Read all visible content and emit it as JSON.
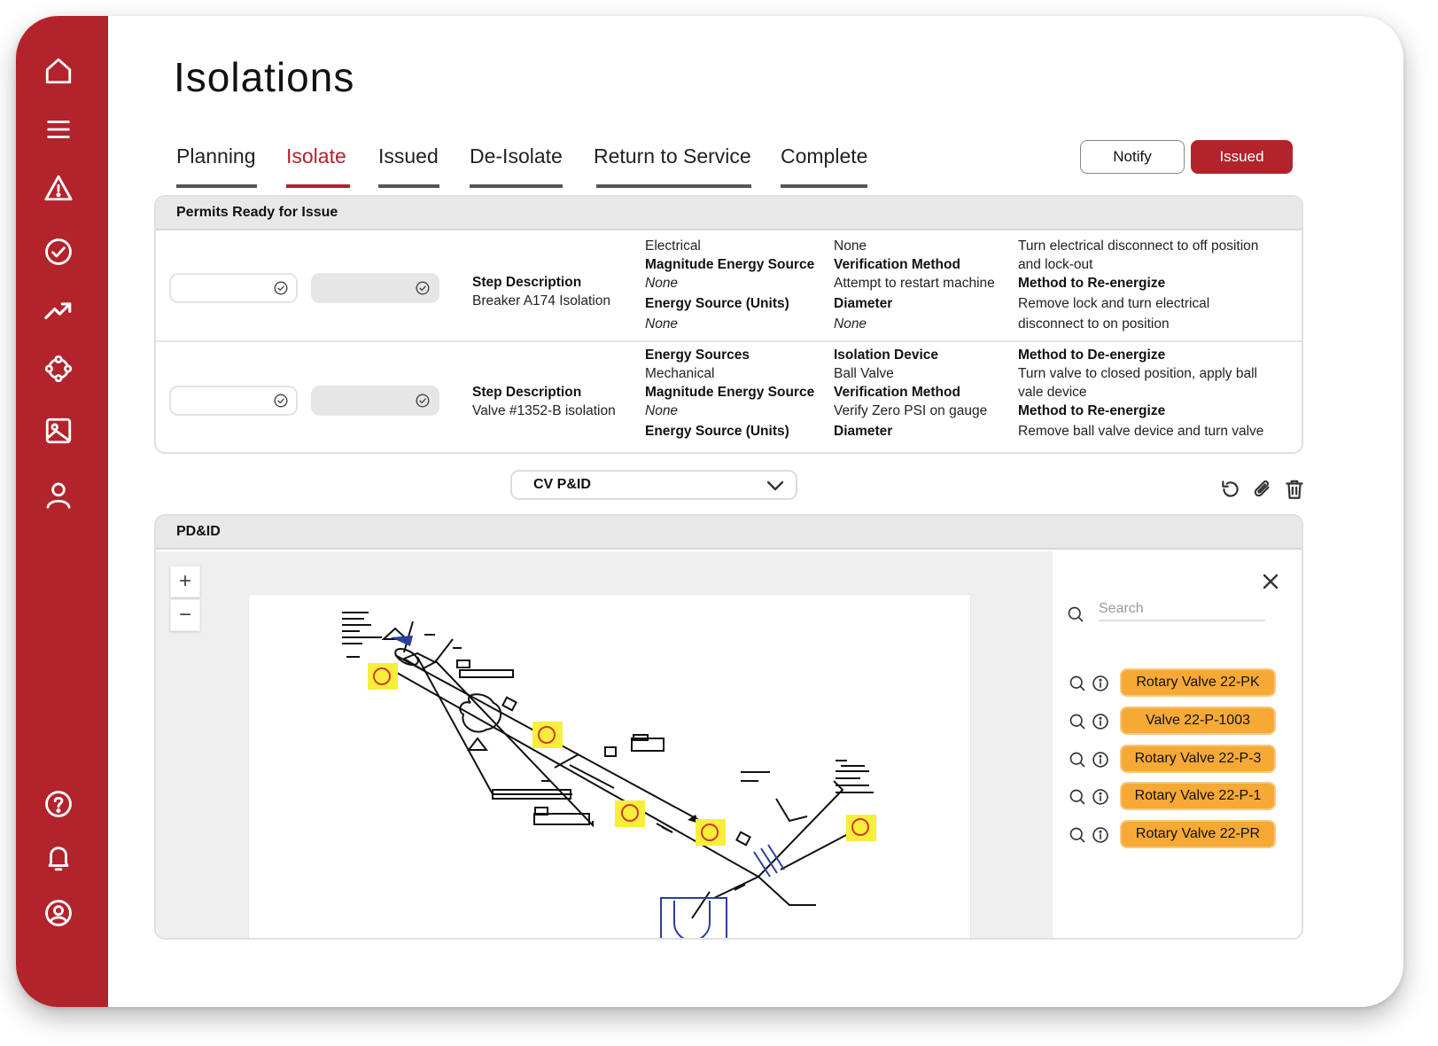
{
  "page": {
    "title": "Isolations"
  },
  "tabs": [
    {
      "label": "Planning"
    },
    {
      "label": "Isolate",
      "active": true
    },
    {
      "label": "Issued"
    },
    {
      "label": "De-Isolate"
    },
    {
      "label": "Return to Service"
    },
    {
      "label": "Complete"
    }
  ],
  "actions": {
    "notify_label": "Notify",
    "issued_label": "Issued"
  },
  "colors": {
    "brand_red": "#b3232b",
    "chip_orange": "#f6a935",
    "marker_yellow": "#f7ef3a",
    "diagram_blue": "#2b3f9c"
  },
  "sidebar": {
    "top_icons": [
      "home-icon",
      "menu-icon",
      "warning-icon",
      "check-circle-icon",
      "trending-icon",
      "network-icon",
      "image-icon",
      "user-icon"
    ],
    "bottom_icons": [
      "help-icon",
      "bell-icon",
      "account-icon"
    ]
  },
  "permits": {
    "header": "Permits Ready for Issue",
    "rows": [
      {
        "step_label": "Step Description",
        "step_value": "Breaker A174 Isolation",
        "c1": [
          "Electrical",
          "Magnitude Energy Source",
          "None",
          "Energy Source (Units)",
          "None"
        ],
        "c2": [
          "None",
          "Verification Method",
          "Attempt to restart machine",
          "Diameter",
          "None"
        ],
        "c3": [
          "Turn electrical disconnect to off position",
          "and lock-out",
          "Method to Re-energize",
          "Remove lock and turn electrical",
          "disconnect to on position"
        ]
      },
      {
        "step_label": "Step Description",
        "step_value": "Valve #1352-B isolation",
        "c1": [
          "Energy Sources",
          "Mechanical",
          "Magnitude Energy Source",
          "None",
          "Energy Source (Units)"
        ],
        "c2": [
          "Isolation Device",
          "Ball Valve",
          "Verification Method",
          "Verify Zero PSI on gauge",
          "Diameter"
        ],
        "c3": [
          "Method to De-energize",
          "Turn valve to closed position, apply ball",
          "vale device",
          "Method to Re-energize",
          "Remove ball valve device and turn valve"
        ]
      }
    ]
  },
  "diagram_select": {
    "value": "CV P&ID"
  },
  "pid": {
    "header": "PD&ID",
    "zoom_in": "+",
    "zoom_out": "−",
    "search_placeholder": "Search",
    "valves": [
      "Rotary Valve 22-PK",
      "Valve 22-P-1003",
      "Rotary Valve 22-P-3",
      "Rotary Valve 22-P-1",
      "Rotary Valve 22-PR"
    ]
  }
}
